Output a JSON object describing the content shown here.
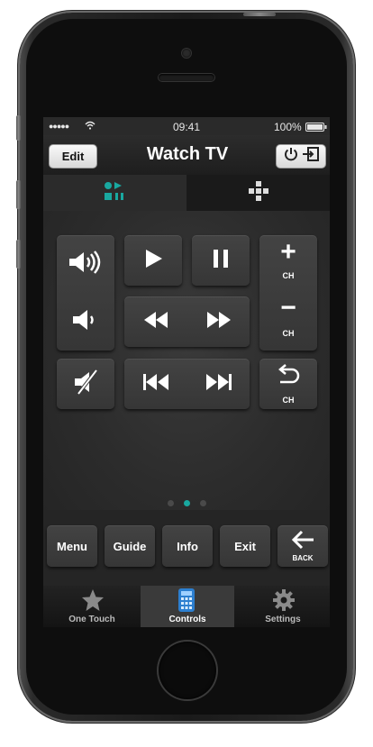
{
  "status_bar": {
    "signal": "●●●●●",
    "time": "09:41",
    "battery": "100%"
  },
  "nav": {
    "edit_label": "Edit",
    "title": "Watch TV",
    "power_icon": "power-input-icon"
  },
  "top_tabs": [
    {
      "icon": "media-controls-icon",
      "active": true
    },
    {
      "icon": "dpad-icon",
      "active": false
    }
  ],
  "remote_buttons": {
    "volume_up_icon": "volume-up-icon",
    "volume_down_icon": "volume-down-icon",
    "mute_icon": "mute-icon",
    "play_icon": "play-icon",
    "pause_icon": "pause-icon",
    "rewind_icon": "rewind-icon",
    "fast_forward_icon": "fast-forward-icon",
    "skip_back_icon": "skip-back-icon",
    "skip_forward_icon": "skip-forward-icon",
    "ch_up": {
      "symbol": "+",
      "label": "CH"
    },
    "ch_down": {
      "symbol": "−",
      "label": "CH"
    },
    "ch_prev": {
      "label": "CH"
    }
  },
  "page_indicator": {
    "count": 3,
    "active": 2
  },
  "function_row": [
    {
      "label": "Menu"
    },
    {
      "label": "Guide"
    },
    {
      "label": "Info"
    },
    {
      "label": "Exit"
    },
    {
      "label": "BACK"
    }
  ],
  "bottom_tabs": [
    {
      "label": "One Touch",
      "icon": "star-icon",
      "active": false
    },
    {
      "label": "Controls",
      "icon": "remote-icon",
      "active": true
    },
    {
      "label": "Settings",
      "icon": "gear-icon",
      "active": false
    }
  ],
  "colors": {
    "accent": "#19a8a0",
    "button": "#3c3c3c",
    "background": "#2a2a2a"
  }
}
